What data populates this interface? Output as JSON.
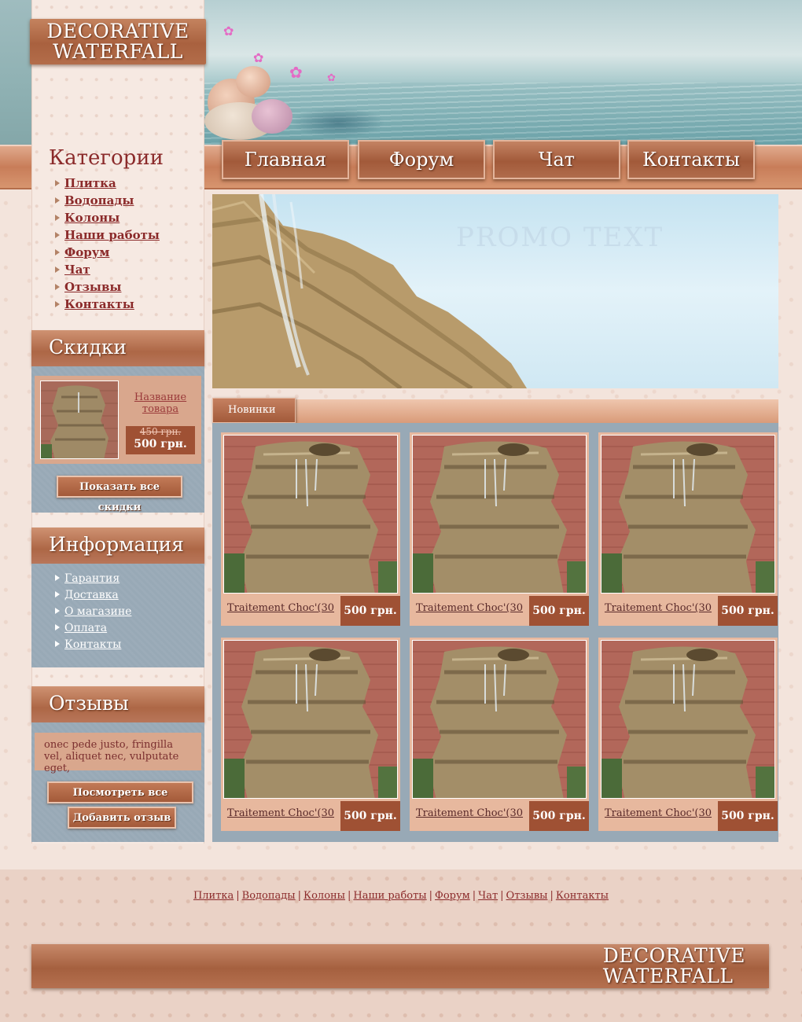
{
  "logo": {
    "line1": "DECORATIVE",
    "line2": "WATERFALL"
  },
  "nav": [
    {
      "label": "Главная"
    },
    {
      "label": "Форум"
    },
    {
      "label": "Чат"
    },
    {
      "label": "Контакты"
    }
  ],
  "categories": {
    "title": "Категории",
    "items": [
      "Плитка",
      "Водопады",
      "Колоны",
      "Наши работы",
      "Форум",
      "Чат",
      "Отзывы",
      "Контакты"
    ]
  },
  "discounts": {
    "title": "Скидки",
    "product_name": "Название товара",
    "old_price": "450 грн.",
    "new_price": "500 грн.",
    "show_all_button": "Показать все скидки"
  },
  "info": {
    "title": "Информация",
    "items": [
      "Гарантия",
      "Доставка",
      "О магазине",
      "Оплата",
      "Контакты"
    ]
  },
  "reviews": {
    "title": "Отзывы",
    "text": "onec pede justo, fringilla vel, aliquet nec, vulputate eget,",
    "view_all_button": "Посмотреть все отзывы",
    "add_button": "Добавить отзыв"
  },
  "promo": {
    "watermark": "PROMO TEXT"
  },
  "new_items": {
    "tab_label": "Новинки",
    "products": [
      {
        "name": "Traitement Choc'(30",
        "price": "500 грн."
      },
      {
        "name": "Traitement Choc'(30",
        "price": "500 грн."
      },
      {
        "name": "Traitement Choc'(30",
        "price": "500 грн."
      },
      {
        "name": "Traitement Choc'(30",
        "price": "500 грн."
      },
      {
        "name": "Traitement Choc'(30",
        "price": "500 грн."
      },
      {
        "name": "Traitement Choc'(30",
        "price": "500 грн."
      }
    ]
  },
  "footer": {
    "links": [
      "Плитка",
      "Водопады",
      "Колоны",
      "Наши работы",
      "Форум",
      "Чат",
      "Отзывы",
      "Контакты"
    ],
    "logo_line1": "DECORATIVE",
    "logo_line2": "WATERFALL"
  },
  "colors": {
    "accent": "#a55d3c",
    "title_red": "#8b2a2a",
    "panel_blue": "#98a9b6",
    "page_bg": "#f3e4dc"
  }
}
